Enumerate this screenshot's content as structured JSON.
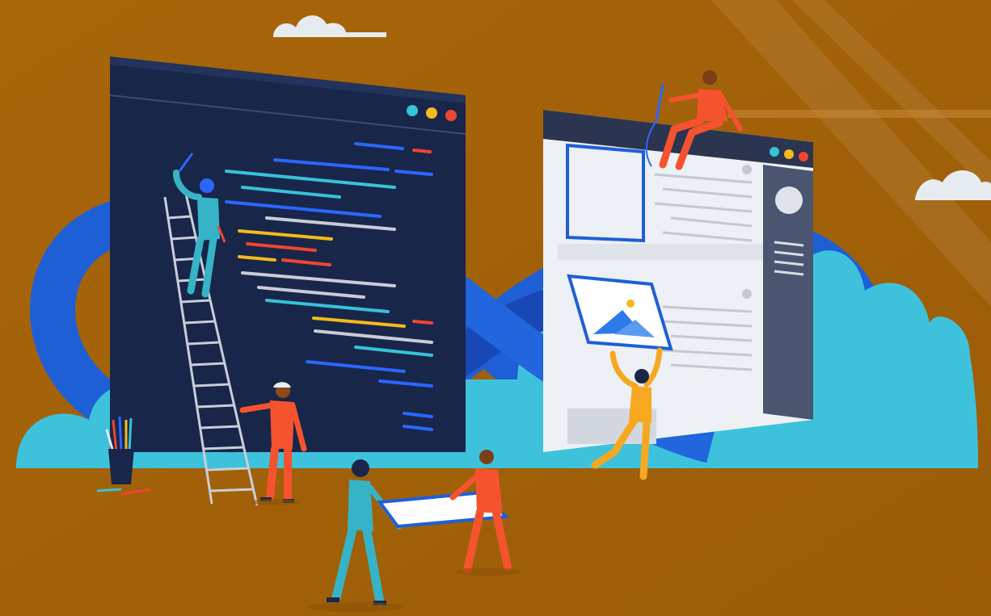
{
  "illustration": {
    "subject": "devops-infinity-loop-illustration",
    "colors": {
      "background": "#a8660a",
      "background_dark": "#9a5c08",
      "cloud_light": "#e9eef3",
      "cloud_cyan": "#3ec2db",
      "loop_blue": "#1f5fd6",
      "loop_blue_dark": "#1748b3",
      "code_window": "#18264a",
      "code_window_border": "#2a3a63",
      "ui_window": "#edf0f4",
      "ui_window_header": "#2b3550",
      "ui_sidebar": "#4a5670",
      "dot_cyan": "#37c2d8",
      "dot_yellow": "#f6b91a",
      "dot_red": "#f0452f",
      "person_orange": "#f5532d",
      "person_teal": "#37b3c7",
      "person_yellow": "#f6a821",
      "ladder": "#c9ced8"
    },
    "icons": [
      "cloud-icon",
      "code-window-icon",
      "ui-mockup-window-icon",
      "infinity-loop-icon",
      "ladder-icon",
      "pencil-cup-icon",
      "image-placeholder-icon"
    ]
  }
}
